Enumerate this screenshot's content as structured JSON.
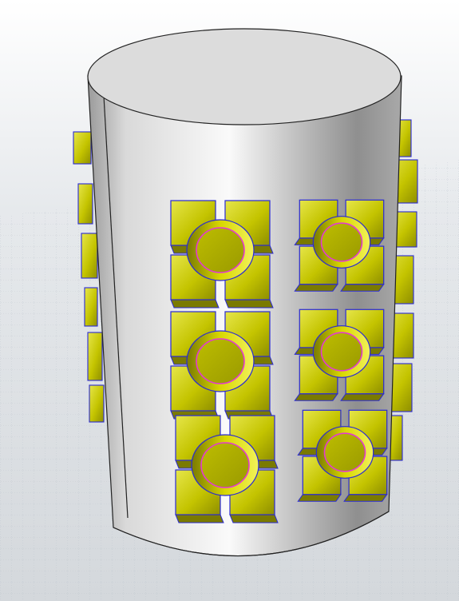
{
  "viewport": {
    "name": "3d-modeling-viewport",
    "background_top": "#ffffff",
    "background_bottom": "#d4d8dc",
    "grid_color": "#b3bcc6"
  },
  "model": {
    "name": "cylinder-with-slot-clusters",
    "body_colors": [
      "#fafafa",
      "#d9d9d9",
      "#b7b7b7",
      "#9a9a9a",
      "#a9a9a9",
      "#8f8f8f"
    ],
    "top_face_color": "#dcdcdc",
    "outline_color": "#222222",
    "block_color": "#c4c400",
    "block_highlight": "#e6e64a",
    "block_shadow": "#7a7a00",
    "block_edge_color": "#2a2ad6",
    "selected_edge_color": "#e23ad2",
    "visible_clusters": 6,
    "back_clusters": 6
  }
}
